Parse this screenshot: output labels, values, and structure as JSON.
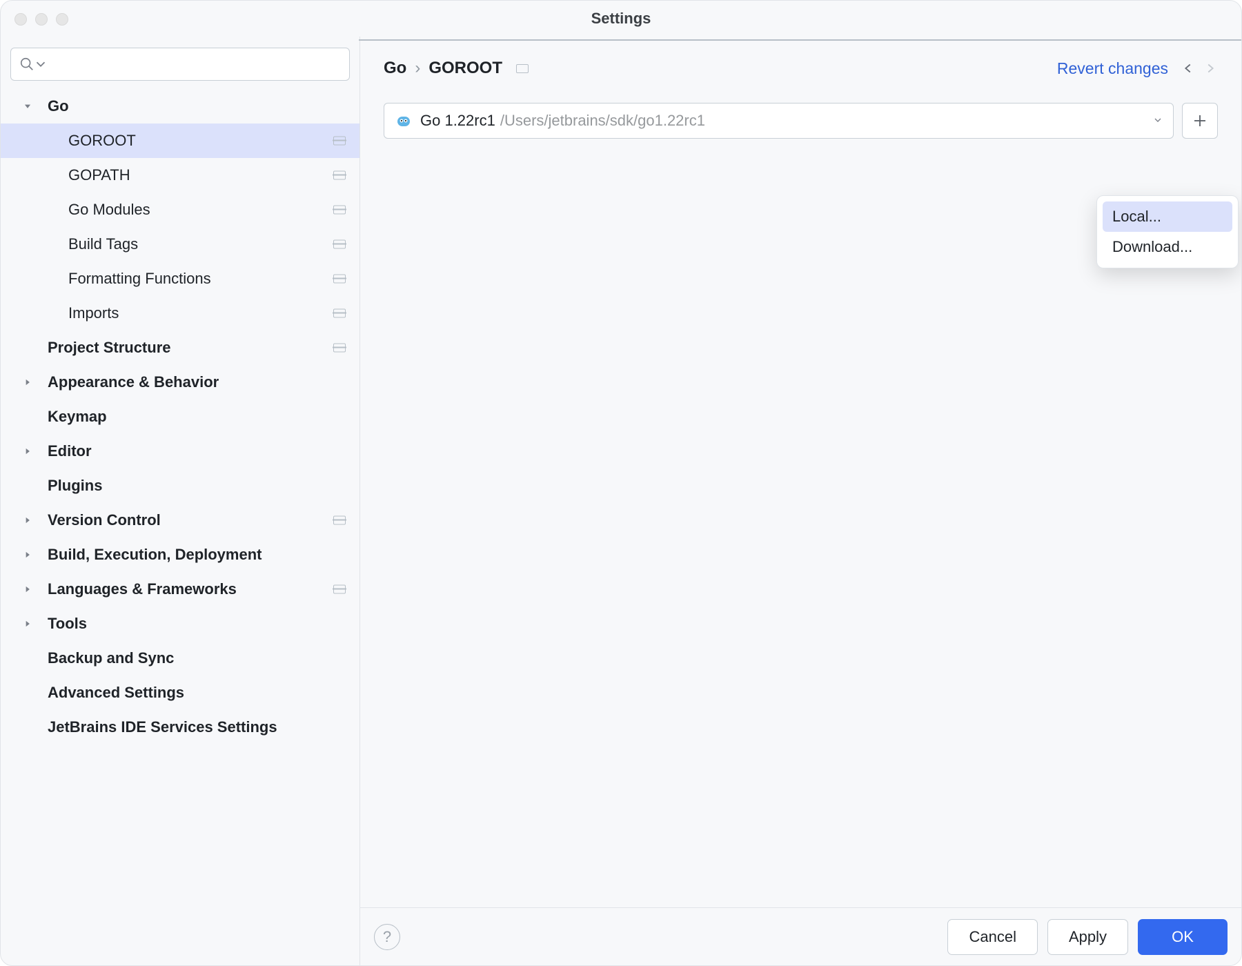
{
  "window_title": "Settings",
  "sidebar": {
    "items": [
      {
        "label": "Go",
        "level": 0,
        "bold": true,
        "arrow": "down",
        "proj": false,
        "selected": false
      },
      {
        "label": "GOROOT",
        "level": 1,
        "bold": false,
        "arrow": "none",
        "proj": true,
        "selected": true
      },
      {
        "label": "GOPATH",
        "level": 1,
        "bold": false,
        "arrow": "none",
        "proj": true,
        "selected": false
      },
      {
        "label": "Go Modules",
        "level": 1,
        "bold": false,
        "arrow": "none",
        "proj": true,
        "selected": false
      },
      {
        "label": "Build Tags",
        "level": 1,
        "bold": false,
        "arrow": "none",
        "proj": true,
        "selected": false
      },
      {
        "label": "Formatting Functions",
        "level": 1,
        "bold": false,
        "arrow": "none",
        "proj": true,
        "selected": false
      },
      {
        "label": "Imports",
        "level": 1,
        "bold": false,
        "arrow": "none",
        "proj": true,
        "selected": false
      },
      {
        "label": "Project Structure",
        "level": 0,
        "bold": true,
        "arrow": "blank",
        "proj": true,
        "selected": false
      },
      {
        "label": "Appearance & Behavior",
        "level": 0,
        "bold": true,
        "arrow": "right",
        "proj": false,
        "selected": false
      },
      {
        "label": "Keymap",
        "level": 0,
        "bold": true,
        "arrow": "blank",
        "proj": false,
        "selected": false
      },
      {
        "label": "Editor",
        "level": 0,
        "bold": true,
        "arrow": "right",
        "proj": false,
        "selected": false
      },
      {
        "label": "Plugins",
        "level": 0,
        "bold": true,
        "arrow": "blank",
        "proj": false,
        "selected": false
      },
      {
        "label": "Version Control",
        "level": 0,
        "bold": true,
        "arrow": "right",
        "proj": true,
        "selected": false
      },
      {
        "label": "Build, Execution, Deployment",
        "level": 0,
        "bold": true,
        "arrow": "right",
        "proj": false,
        "selected": false
      },
      {
        "label": "Languages & Frameworks",
        "level": 0,
        "bold": true,
        "arrow": "right",
        "proj": true,
        "selected": false
      },
      {
        "label": "Tools",
        "level": 0,
        "bold": true,
        "arrow": "right",
        "proj": false,
        "selected": false
      },
      {
        "label": "Backup and Sync",
        "level": 0,
        "bold": true,
        "arrow": "blank",
        "proj": false,
        "selected": false
      },
      {
        "label": "Advanced Settings",
        "level": 0,
        "bold": true,
        "arrow": "blank",
        "proj": false,
        "selected": false
      },
      {
        "label": "JetBrains IDE Services Settings",
        "level": 0,
        "bold": true,
        "arrow": "blank",
        "proj": false,
        "selected": false
      }
    ]
  },
  "breadcrumb": {
    "part1": "Go",
    "sep": "›",
    "part2": "GOROOT"
  },
  "revert_label": "Revert changes",
  "sdk": {
    "name": "Go 1.22rc1",
    "path": "/Users/jetbrains/sdk/go1.22rc1"
  },
  "popup": {
    "option1": "Local...",
    "option2": "Download..."
  },
  "buttons": {
    "help": "?",
    "cancel": "Cancel",
    "apply": "Apply",
    "ok": "OK"
  }
}
